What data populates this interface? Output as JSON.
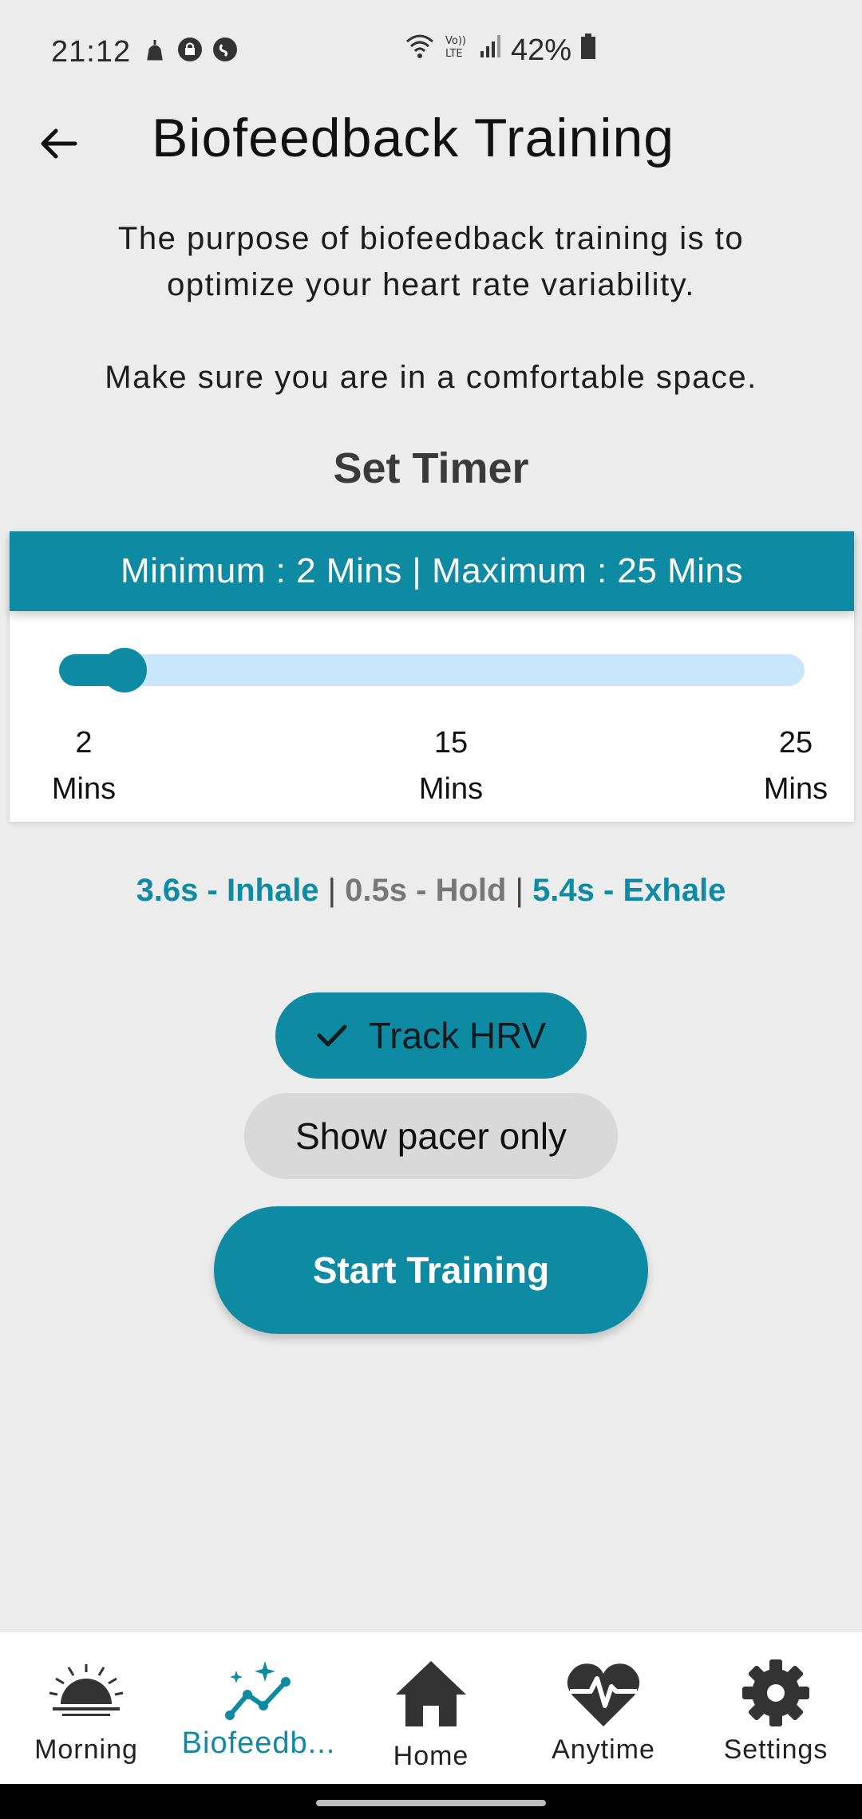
{
  "status_bar": {
    "time": "21:12",
    "battery": "42%"
  },
  "header": {
    "title": "Biofeedback Training"
  },
  "intro": {
    "line1": "The purpose of biofeedback training is to",
    "line2": "optimize your heart rate variability.",
    "line3": "Make sure you are in a comfortable space."
  },
  "timer": {
    "heading": "Set Timer",
    "range_label": "Minimum : 2 Mins | Maximum : 25 Mins",
    "min": 2,
    "max": 25,
    "value": 2,
    "tick_min_value": "2",
    "tick_min_unit": "Mins",
    "tick_mid_value": "15",
    "tick_mid_unit": "Mins",
    "tick_max_value": "25",
    "tick_max_unit": "Mins"
  },
  "breathing": {
    "inhale": "3.6s - Inhale",
    "hold": "0.5s - Hold",
    "exhale": "5.4s - Exhale",
    "separator": " | "
  },
  "buttons": {
    "track_hrv": "Track HRV",
    "show_pacer": "Show pacer only",
    "start": "Start Training"
  },
  "nav": {
    "items": [
      {
        "label": "Morning",
        "icon": "sunrise-icon"
      },
      {
        "label": "Biofeedb...",
        "icon": "sparkle-graph-icon"
      },
      {
        "label": "Home",
        "icon": "home-icon"
      },
      {
        "label": "Anytime",
        "icon": "heartbeat-icon"
      },
      {
        "label": "Settings",
        "icon": "gear-icon"
      }
    ],
    "active_index": 1
  },
  "colors": {
    "accent": "#0f8aa3",
    "track": "#c9e6fb",
    "background": "#ececec"
  }
}
